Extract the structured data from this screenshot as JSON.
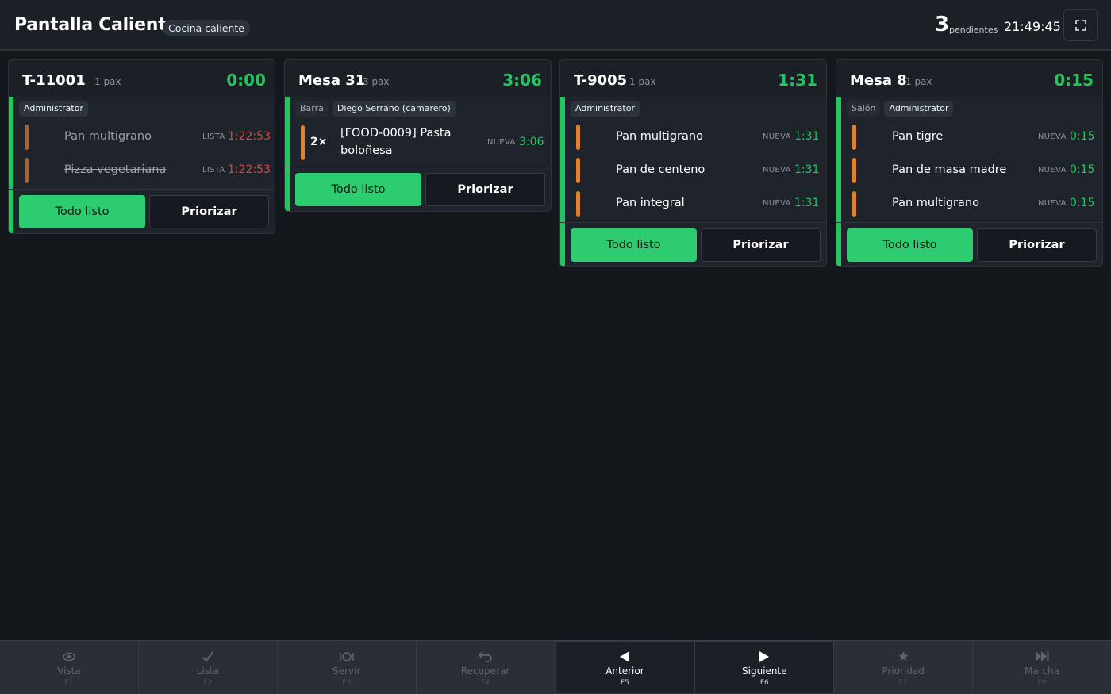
{
  "header": {
    "title": "Pantalla Caliente",
    "station": "Cocina caliente",
    "pending_count": "3",
    "pending_label": "pendientes",
    "clock": "21:49:45"
  },
  "cards": [
    {
      "title": "T-11001",
      "pax": "1 pax",
      "timer": "0:00",
      "tags": [
        "Administrator"
      ],
      "items": [
        {
          "name": "Pan multigrano",
          "status": "LISTA",
          "time": "1:22:53"
        },
        {
          "name": "Pizza vegetariana",
          "status": "LISTA",
          "time": "1:22:53"
        }
      ],
      "ready_label": "Todo listo",
      "priority_label": "Priorizar"
    },
    {
      "title": "Mesa 31",
      "pax": "3 pax",
      "timer": "3:06",
      "tags": [
        "Barra",
        "Diego Serrano (camarero)"
      ],
      "items": [
        {
          "qty": "2×",
          "name": "[FOOD-0009] Pasta boloñesa",
          "status": "NUEVA",
          "time": "3:06"
        }
      ],
      "ready_label": "Todo listo",
      "priority_label": "Priorizar"
    },
    {
      "title": "T-9005",
      "pax": "1 pax",
      "timer": "1:31",
      "tags": [
        "Administrator"
      ],
      "items": [
        {
          "name": "Pan multigrano",
          "status": "NUEVA",
          "time": "1:31"
        },
        {
          "name": "Pan de centeno",
          "status": "NUEVA",
          "time": "1:31"
        },
        {
          "name": "Pan integral",
          "status": "NUEVA",
          "time": "1:31"
        }
      ],
      "ready_label": "Todo listo",
      "priority_label": "Priorizar"
    },
    {
      "title": "Mesa 8",
      "pax": "1 pax",
      "timer": "0:15",
      "tags": [
        "Salón",
        "Administrator"
      ],
      "items": [
        {
          "name": "Pan tigre",
          "status": "NUEVA",
          "time": "0:15"
        },
        {
          "name": "Pan de masa madre",
          "status": "NUEVA",
          "time": "0:15"
        },
        {
          "name": "Pan multigrano",
          "status": "NUEVA",
          "time": "0:15"
        }
      ],
      "ready_label": "Todo listo",
      "priority_label": "Priorizar"
    }
  ],
  "toolbar": [
    {
      "label": "Vista",
      "key": "F1",
      "icon": "eye-icon"
    },
    {
      "label": "Lista",
      "key": "F2",
      "icon": "check-icon"
    },
    {
      "label": "Servir",
      "key": "F3",
      "icon": "dish-icon"
    },
    {
      "label": "Recuperar",
      "key": "F4",
      "icon": "undo-icon"
    },
    {
      "label": "Anterior",
      "key": "F5",
      "icon": "prev-icon"
    },
    {
      "label": "Siguiente",
      "key": "F6",
      "icon": "next-icon"
    },
    {
      "label": "Prioridad",
      "key": "F7",
      "icon": "star-icon"
    },
    {
      "label": "Marcha",
      "key": "F8",
      "icon": "fast-forward-icon"
    }
  ],
  "colors": {
    "accent": "#22c55e",
    "late": "#d9463b",
    "item_bar": "#e0822a",
    "background": "#14171c"
  }
}
